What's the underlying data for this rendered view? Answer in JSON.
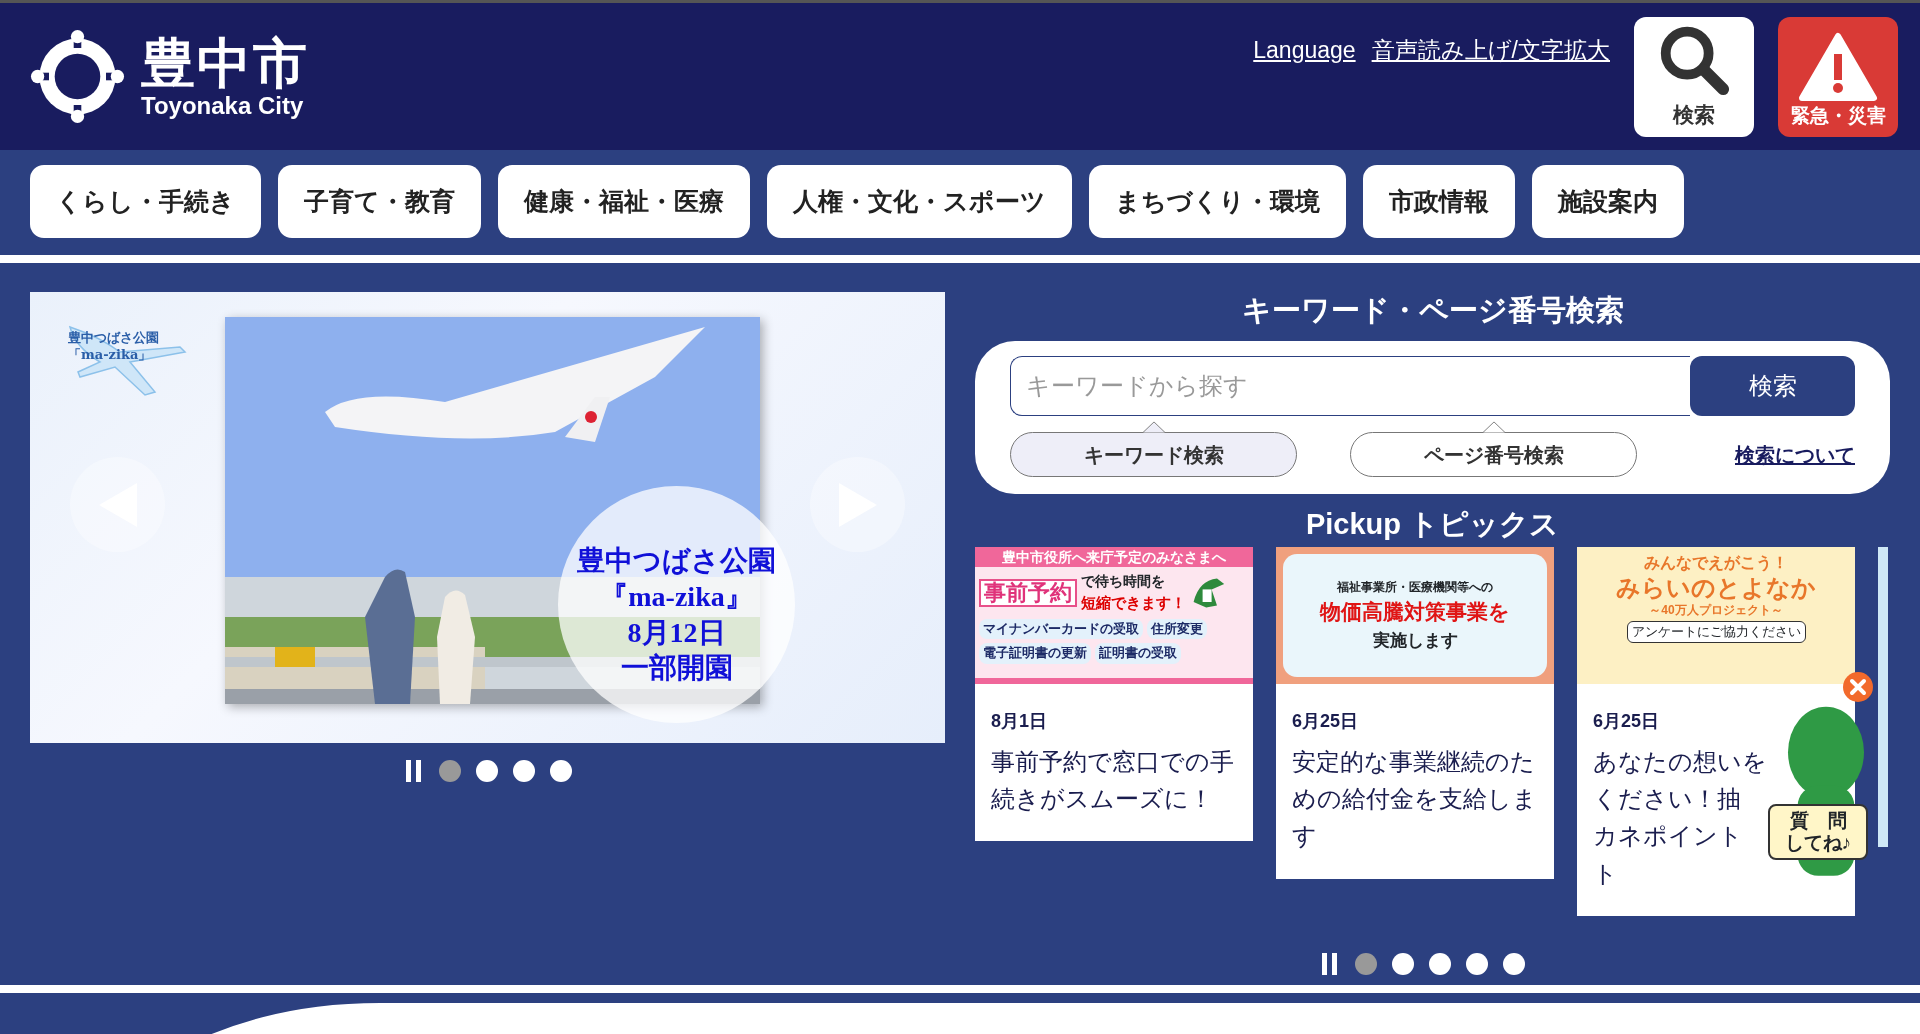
{
  "header": {
    "logo_name": "豊中市",
    "logo_romaji": "Toyonaka City",
    "links": [
      "Language",
      "音声読み上げ/文字拡大"
    ],
    "search_button": "検索",
    "emergency_button": "緊急・災害"
  },
  "nav": [
    "くらし・手続き",
    "子育て・教育",
    "健康・福祉・医療",
    "人権・文化・スポーツ",
    "まちづくり・環境",
    "市政情報",
    "施設案内"
  ],
  "slider": {
    "logo_lines": [
      "豊中つばさ公園",
      "「ma-zika」"
    ],
    "caption_lines": [
      "豊中つばさ公園",
      "『ma-zika』",
      "8月12日",
      "一部開園"
    ],
    "dots": [
      {
        "selected": true
      },
      {
        "selected": false
      },
      {
        "selected": false
      },
      {
        "selected": false
      }
    ]
  },
  "search": {
    "title": "キーワード・ページ番号検索",
    "placeholder": "キーワードから探す",
    "button": "検索",
    "tabs": [
      {
        "label": "キーワード検索",
        "selected": true
      },
      {
        "label": "ページ番号検索",
        "selected": false
      }
    ],
    "help_link": "検索について"
  },
  "pickup": {
    "title": "Pickup トピックス",
    "cards": [
      {
        "kind": "reservation",
        "banner": [
          "豊中市役所へ来庁予定のみなさまへ",
          "事前予約",
          "で待ち時間を",
          "短縮できます！",
          "マイナンバーカードの受取",
          "住所変更",
          "電子証明書の更新",
          "証明書の受取"
        ],
        "date": "8月1日",
        "lines": [
          "事前予約で窓口での手",
          "続きがスムーズに！"
        ]
      },
      {
        "kind": "notice",
        "banner": [
          "福祉事業所・医療機関等への",
          "物価高騰対策事業を",
          "実施します"
        ],
        "date": "6月25日",
        "lines": [
          "安定的な事業継続のた",
          "めの給付金を支給しま",
          "す"
        ]
      },
      {
        "kind": "survey",
        "banner": [
          "みんなでえがこう！",
          "みらいのとよなか",
          "～40万人プロジェクト～",
          "アンケートにご協力ください"
        ],
        "date": "6月25日",
        "lines": [
          "あなたの想いを",
          "ください！抽",
          "カネポイント",
          "ト"
        ]
      }
    ],
    "dots": [
      {
        "selected": true
      },
      {
        "selected": false
      },
      {
        "selected": false
      },
      {
        "selected": false
      },
      {
        "selected": false
      }
    ]
  },
  "chat_widget": {
    "label_lines": [
      "質　問",
      "してね♪"
    ]
  }
}
